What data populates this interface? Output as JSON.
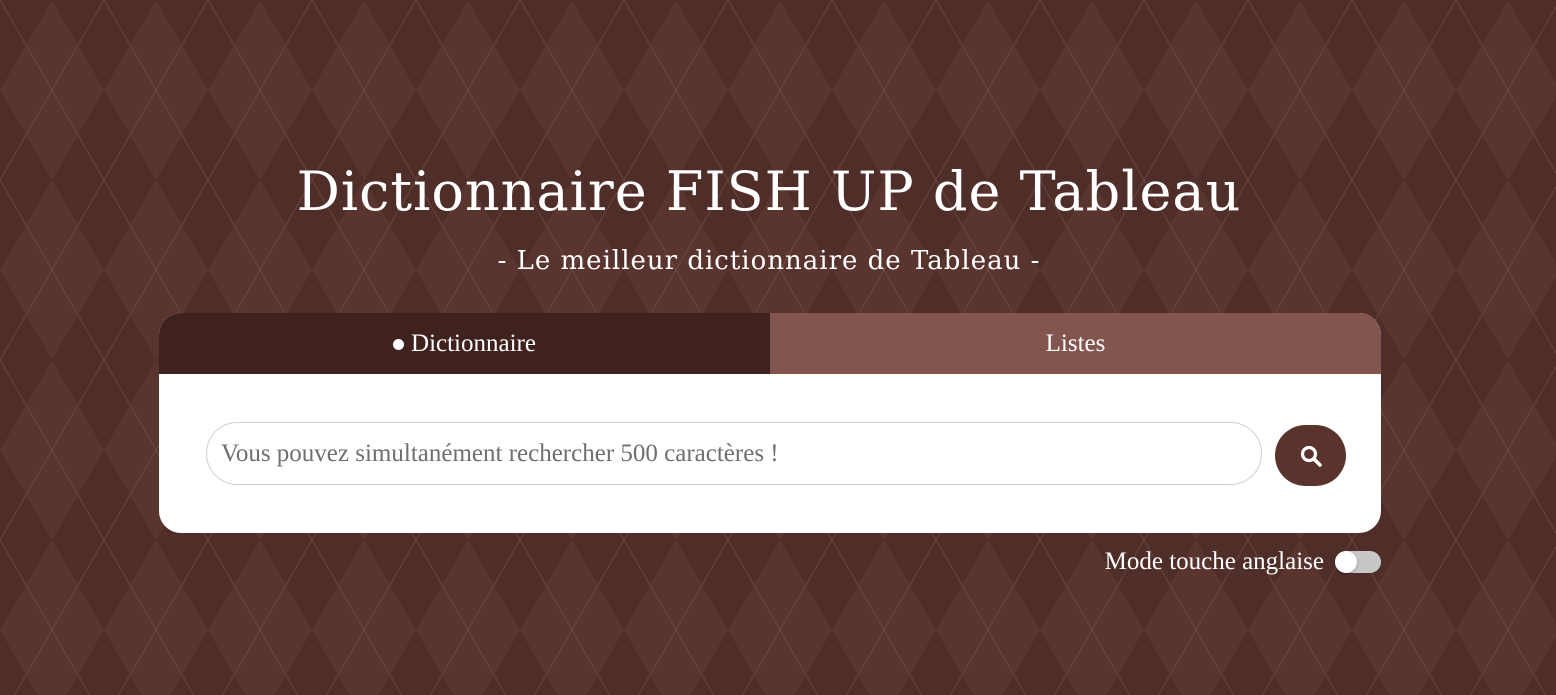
{
  "colors": {
    "background": "#4f2d28",
    "background_alt": "#5a3530",
    "tab_active": "#3f221e",
    "tab_inactive": "#82554f",
    "search_button": "#5a332d",
    "toggle_off": "#c7c7c7"
  },
  "header": {
    "title": "Dictionnaire FISH UP de Tableau",
    "subtitle": "- Le meilleur dictionnaire de Tableau -"
  },
  "tabs": [
    {
      "label": "Dictionnaire",
      "active": true
    },
    {
      "label": "Listes",
      "active": false
    }
  ],
  "search": {
    "placeholder": "Vous pouvez simultanément rechercher 500 caractères !",
    "value": "",
    "button_icon": "search-icon"
  },
  "mode": {
    "label": "Mode touche anglaise",
    "enabled": false
  }
}
